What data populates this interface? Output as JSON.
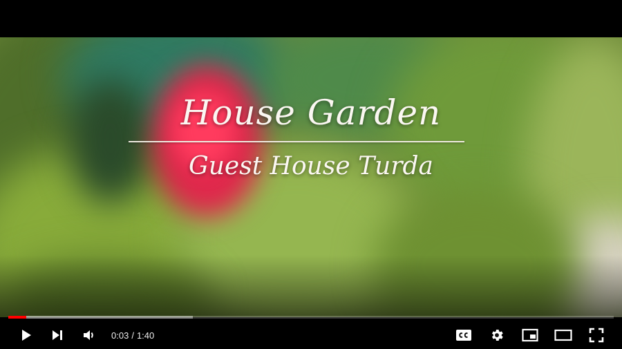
{
  "video": {
    "title_main": "House Garden",
    "title_sub": "Guest House Turda"
  },
  "player": {
    "current_time": "0:03",
    "time_separator": "/",
    "duration": "1:40",
    "played_fraction": 0.03,
    "loaded_fraction": 0.305,
    "accent_color": "#ff0000"
  },
  "icons": {
    "play": "play-icon",
    "next": "next-icon",
    "volume": "volume-icon",
    "captions": "captions-icon",
    "settings": "gear-icon",
    "miniplayer": "miniplayer-icon",
    "theater": "theater-mode-icon",
    "fullscreen": "fullscreen-icon"
  }
}
